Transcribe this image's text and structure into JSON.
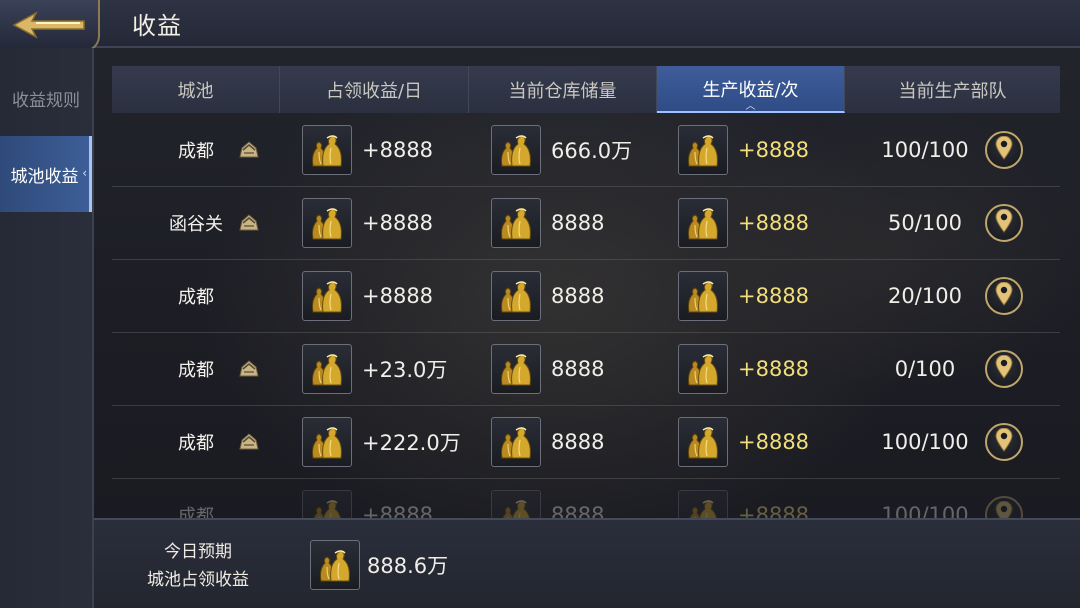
{
  "header": {
    "title": "收益"
  },
  "sidenav": {
    "items": [
      {
        "label": "收益规则",
        "active": false
      },
      {
        "label": "城池收益",
        "active": true
      }
    ]
  },
  "table": {
    "columns": [
      "城池",
      "占领收益/日",
      "当前仓库储量",
      "生产收益/次",
      "当前生产部队"
    ],
    "active_column": 3,
    "rows": [
      {
        "city": "成都",
        "rank_icon": true,
        "occupy": "+8888",
        "storage": "666.0万",
        "produce": "+8888",
        "troops": "100/100"
      },
      {
        "city": "函谷关",
        "rank_icon": true,
        "occupy": "+8888",
        "storage": "8888",
        "produce": "+8888",
        "troops": "50/100"
      },
      {
        "city": "成都",
        "rank_icon": false,
        "occupy": "+8888",
        "storage": "8888",
        "produce": "+8888",
        "troops": "20/100"
      },
      {
        "city": "成都",
        "rank_icon": true,
        "occupy": "+23.0万",
        "storage": "8888",
        "produce": "+8888",
        "troops": "0/100"
      },
      {
        "city": "成都",
        "rank_icon": true,
        "occupy": "+222.0万",
        "storage": "8888",
        "produce": "+8888",
        "troops": "100/100"
      },
      {
        "city": "成都",
        "rank_icon": false,
        "occupy": "+8888",
        "storage": "8888",
        "produce": "+8888",
        "troops": "100/100"
      }
    ]
  },
  "footer": {
    "label_line1": "今日预期",
    "label_line2": "城池占领收益",
    "value": "888.6万"
  },
  "icons": {
    "back": "back-arrow-icon",
    "resource": "gold-sack-icon",
    "rank": "rank-badge-icon",
    "location": "map-pin-icon"
  },
  "colors": {
    "accent_blue": "#3d5e98",
    "gold": "#bfa66a",
    "produce_text": "#f1de7b"
  }
}
